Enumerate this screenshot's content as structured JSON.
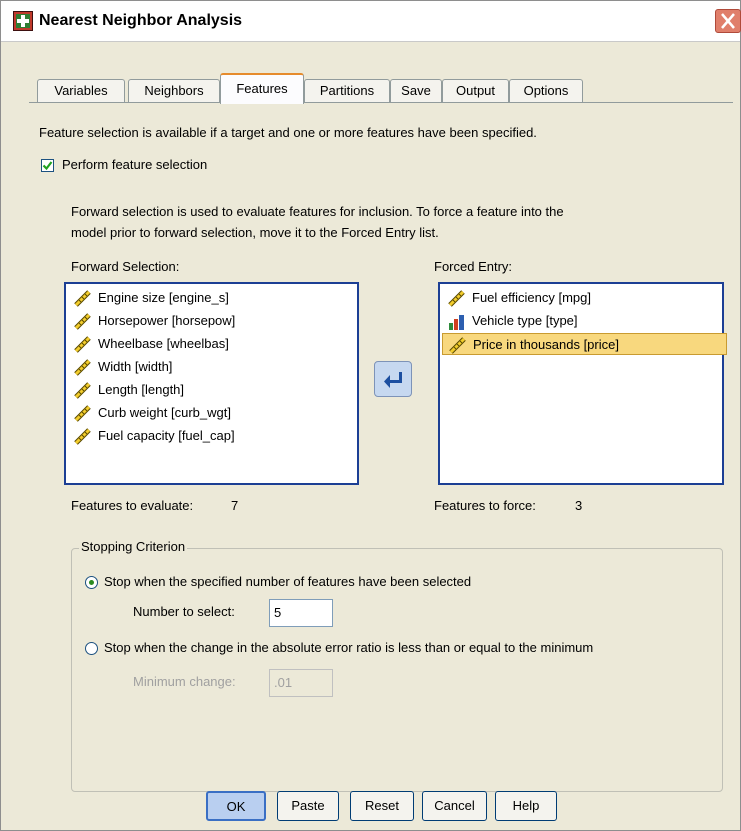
{
  "window": {
    "title": "Nearest Neighbor Analysis",
    "close_icon": "close-x-icon",
    "app_icon": "spss-dialog-icon"
  },
  "tabs": [
    {
      "label": "Variables",
      "active": false
    },
    {
      "label": "Neighbors",
      "active": false
    },
    {
      "label": "Features",
      "active": true
    },
    {
      "label": "Partitions",
      "active": false
    },
    {
      "label": "Save",
      "active": false
    },
    {
      "label": "Output",
      "active": false
    },
    {
      "label": "Options",
      "active": false
    }
  ],
  "info_text": "Feature selection is available if a target and one or more features have been specified.",
  "perform_selection": {
    "label": "Perform feature selection",
    "checked": true
  },
  "description": {
    "line1": "Forward selection is used to evaluate features for inclusion. To force a feature into the",
    "line2": "model prior to forward selection, move it to the Forced Entry list."
  },
  "forward_selection": {
    "label": "Forward Selection:",
    "items": [
      {
        "label": "Engine size [engine_s]",
        "icon": "scale-ruler-icon"
      },
      {
        "label": "Horsepower [horsepow]",
        "icon": "scale-ruler-icon"
      },
      {
        "label": "Wheelbase [wheelbas]",
        "icon": "scale-ruler-icon"
      },
      {
        "label": "Width [width]",
        "icon": "scale-ruler-icon"
      },
      {
        "label": "Length [length]",
        "icon": "scale-ruler-icon"
      },
      {
        "label": "Curb weight [curb_wgt]",
        "icon": "scale-ruler-icon"
      },
      {
        "label": "Fuel capacity [fuel_cap]",
        "icon": "scale-ruler-icon"
      }
    ],
    "count_label": "Features to evaluate:",
    "count_value": "7"
  },
  "forced_entry": {
    "label": "Forced Entry:",
    "items": [
      {
        "label": "Fuel efficiency [mpg]",
        "icon": "scale-ruler-icon",
        "selected": false
      },
      {
        "label": "Vehicle type [type]",
        "icon": "nominal-bars-icon",
        "selected": false
      },
      {
        "label": "Price in thousands [price]",
        "icon": "scale-ruler-icon",
        "selected": true
      }
    ],
    "count_label": "Features to force:",
    "count_value": "3"
  },
  "move_button_icon": "arrow-left-icon",
  "stopping": {
    "group_label": "Stopping Criterion",
    "option1": "Stop when the specified number of features have been selected",
    "option1_selected": true,
    "number_label": "Number to select:",
    "number_value": "5",
    "option2": "Stop when the change in the absolute error ratio is less than or equal to the minimum",
    "option2_selected": false,
    "min_change_label": "Minimum change:",
    "min_change_value": ".01"
  },
  "buttons": {
    "ok": "OK",
    "paste": "Paste",
    "reset": "Reset",
    "cancel": "Cancel",
    "help": "Help"
  }
}
